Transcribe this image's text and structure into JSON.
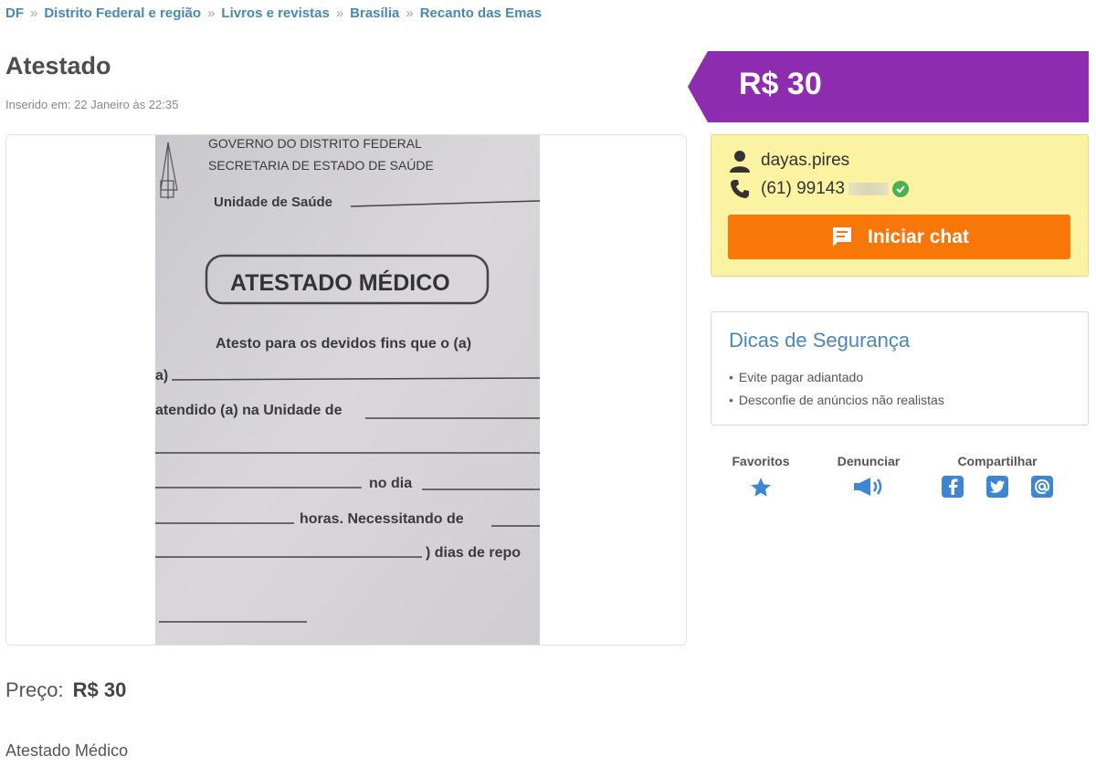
{
  "breadcrumb": {
    "items": [
      "DF",
      "Distrito Federal e região",
      "Livros e revistas",
      "Brasília",
      "Recanto das Emas"
    ],
    "separator": "»"
  },
  "listing": {
    "title": "Atestado",
    "inserted": "Inserido em: 22 Janeiro às 22:35",
    "price_label": "Preço:",
    "price": "R$ 30",
    "description": "Atestado Médico"
  },
  "photo": {
    "line1": "GOVERNO DO DISTRITO FEDERAL",
    "line2": "SECRETARIA DE ESTADO DE SAÚDE",
    "unit_label": "Unidade de Saúde",
    "heading": "ATESTADO MÉDICO",
    "text1": "Atesto para os devidos fins que o (a)",
    "text2a": "a)",
    "text2": "atendido (a) na Unidade de",
    "text3": "no dia",
    "text4": "horas. Necessitando de",
    "text5": ") dias de repo"
  },
  "price_banner": {
    "text": "R$ 30",
    "color": "#8e2cb0"
  },
  "seller": {
    "username": "dayas.pires",
    "phone": "(61) 99143",
    "chat_label": "Iniciar chat",
    "user_icon": "user-icon",
    "phone_icon": "phone-icon",
    "verified_icon": "verified-check-icon"
  },
  "safety": {
    "title": "Dicas de Segurança",
    "tips": [
      "Evite pagar adiantado",
      "Desconfie de anúncios não realistas"
    ]
  },
  "actions": {
    "favorites": "Favoritos",
    "report": "Denunciar",
    "share": "Compartilhar"
  },
  "colors": {
    "accent_blue": "#4a86b8",
    "chat_orange": "#f97609",
    "seller_bg": "#fbf3a1",
    "icon_blue": "#3d86d6"
  }
}
